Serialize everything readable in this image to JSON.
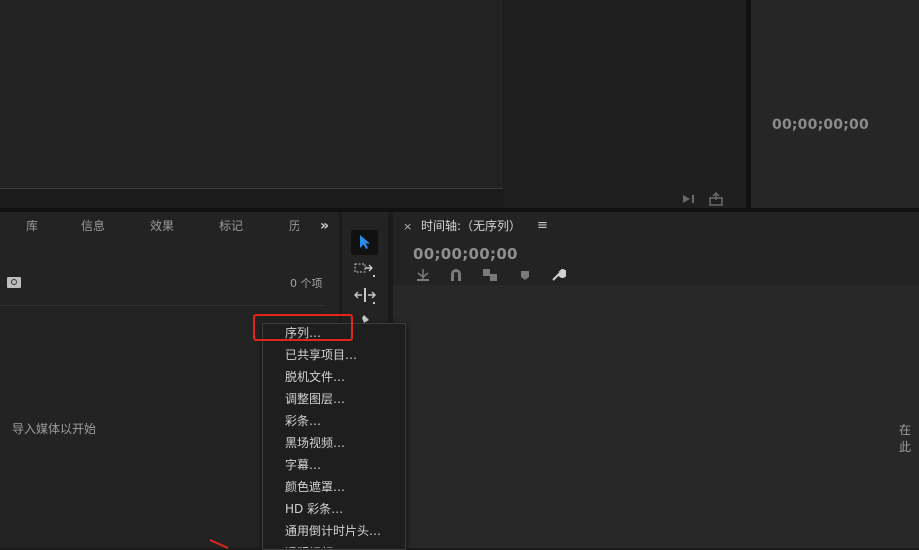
{
  "program_monitor": {
    "timecode": "00;00;00;00"
  },
  "project_panel": {
    "tabs": [
      "库",
      "信息",
      "效果",
      "标记",
      "历"
    ],
    "overflow_glyph": "»",
    "item_count": "0 个项",
    "import_hint": "导入媒体以开始"
  },
  "timeline": {
    "close_glyph": "×",
    "title": "时间轴:（无序列）",
    "menu_glyph": "≡",
    "timecode": "00;00;00;00",
    "side_text": "在此"
  },
  "context_menu": {
    "items": [
      "序列…",
      "已共享项目…",
      "脱机文件…",
      "调整图层…",
      "彩条…",
      "黑场视频…",
      "字幕…",
      "颜色遮罩…",
      "HD 彩条…",
      "通用倒计时片头…",
      "透明视频…"
    ]
  },
  "colors": {
    "annotation_red": "#e0251b",
    "tool_accent": "#2d8ceb"
  }
}
